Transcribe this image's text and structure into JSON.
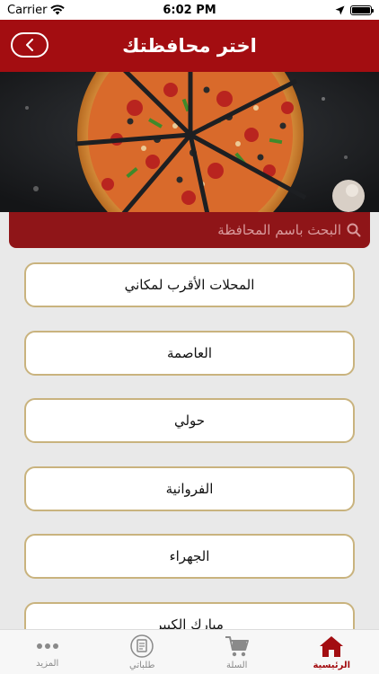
{
  "status_bar": {
    "carrier": "Carrier",
    "time": "6:02 PM",
    "battery_level": 1.0
  },
  "header": {
    "title": "اختر محافظتك",
    "back_icon": "chevron-left-icon"
  },
  "search": {
    "placeholder": "البحث باسم المحافظة",
    "icon": "search-icon"
  },
  "governorates": [
    "المحلات الأقرب لمكاني",
    "العاصمة",
    "حولي",
    "الفروانية",
    "الجهراء",
    "مبارك الكبير"
  ],
  "tabs": [
    {
      "label": "المزيد",
      "icon": "more-dots-icon",
      "active": false
    },
    {
      "label": "طلباتي",
      "icon": "orders-icon",
      "active": false
    },
    {
      "label": "السلة",
      "icon": "cart-icon",
      "active": false
    },
    {
      "label": "الرئيسية",
      "icon": "home-icon",
      "active": true
    }
  ],
  "colors": {
    "brand_red": "#a30d11",
    "item_border": "#c9b37e"
  }
}
